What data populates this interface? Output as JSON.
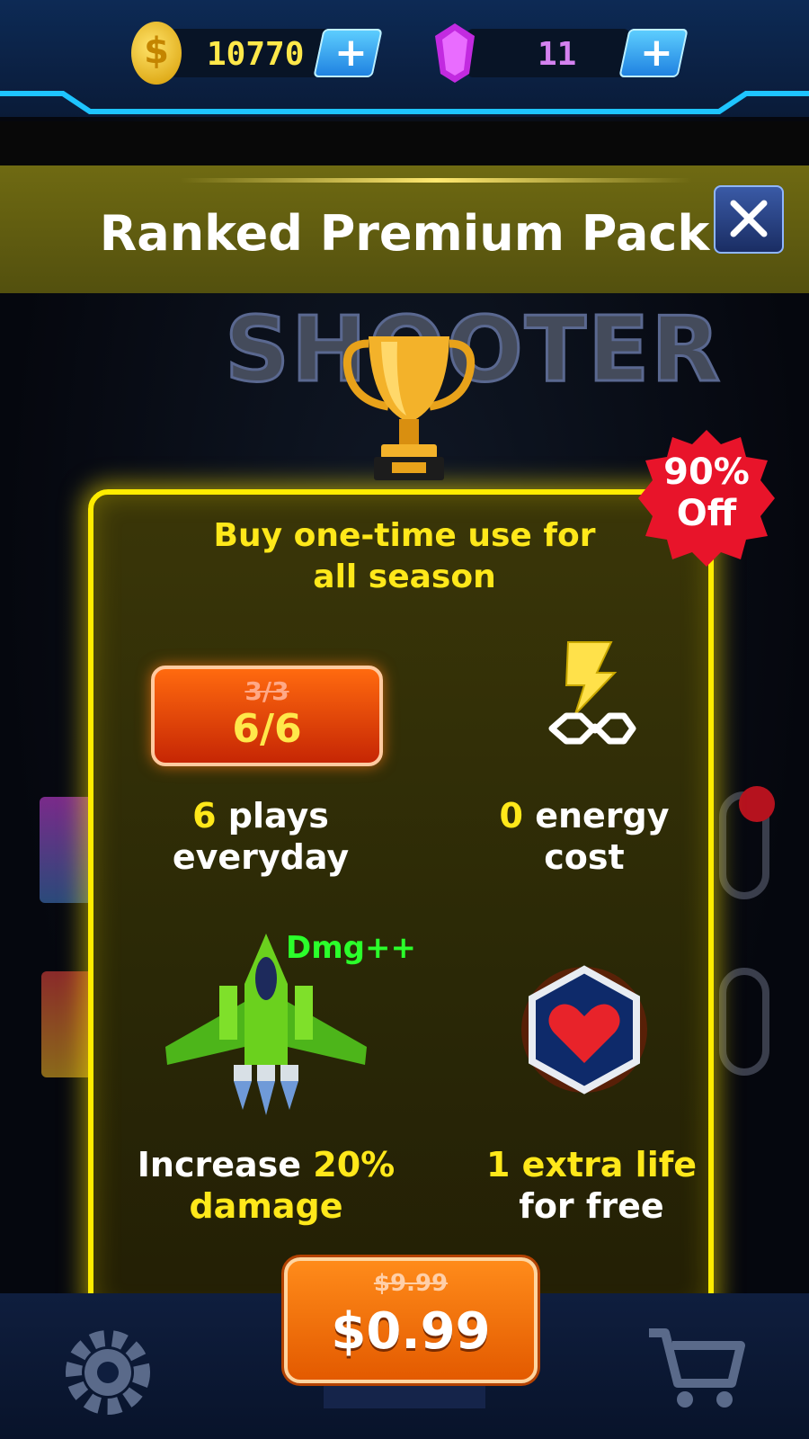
{
  "currency": {
    "coins": "10770",
    "gems": "11",
    "coin_add_label": "+",
    "gem_add_label": "+"
  },
  "header": {
    "title": "Ranked Premium Pack"
  },
  "background": {
    "logo_text": "SHOOTER"
  },
  "panel": {
    "subtitle_line1": "Buy one-time use for",
    "subtitle_line2": "all season",
    "discount_percent": "90%",
    "discount_word": "Off",
    "features": {
      "plays": {
        "old_value": "3/3",
        "new_value": "6/6",
        "caption_highlight": "6",
        "caption_rest": "plays",
        "caption_line2": "everyday"
      },
      "energy": {
        "icon": "lightning-infinity-icon",
        "caption_highlight": "0",
        "caption_rest": "energy",
        "caption_line2": "cost"
      },
      "damage": {
        "icon": "green-spaceship-icon",
        "tag": "Dmg++",
        "caption_prefix": "Increase",
        "caption_highlight": "20%",
        "caption_line2": "damage"
      },
      "life": {
        "icon": "heart-shield-icon",
        "caption_line1": "1 extra life",
        "caption_line2": "for free"
      }
    },
    "price": {
      "old": "$9.99",
      "new": "$0.99"
    }
  },
  "bottom_nav": {
    "left_icon": "gear-icon",
    "center_icon": "ship-icon",
    "right_icon": "cart-icon"
  },
  "colors": {
    "highlight_yellow": "#ffe81a",
    "panel_border": "#ffec00",
    "price_orange": "#ff8b1a",
    "damage_green": "#2bff2b",
    "discount_red": "#e8142a"
  }
}
